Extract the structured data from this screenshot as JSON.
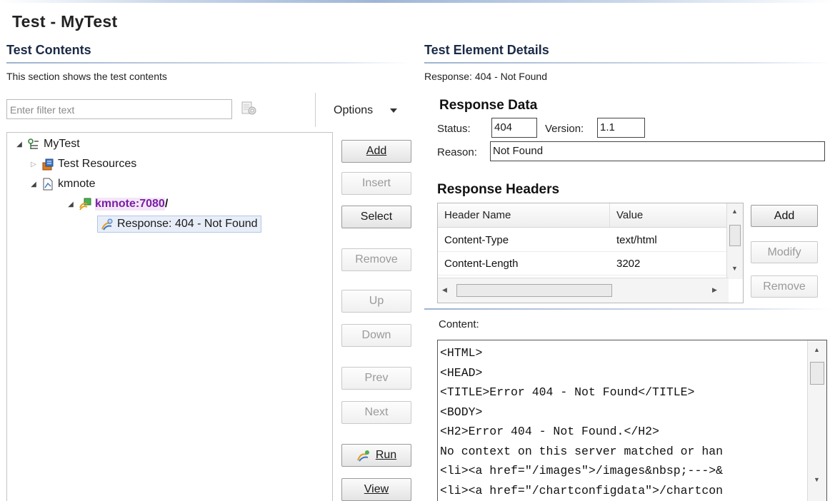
{
  "editor": {
    "title": "Test - MyTest"
  },
  "left": {
    "section_title": "Test Contents",
    "description": "This section shows the test contents",
    "filter_placeholder": "Enter filter text",
    "options_label": "Options",
    "tree": {
      "root": "MyTest",
      "resources": "Test Resources",
      "server": "kmnote",
      "url_host": "kmnote:7080",
      "url_path": "/",
      "response": "Response: 404 - Not Found"
    },
    "buttons": {
      "add": "Add",
      "insert": "Insert",
      "select": "Select",
      "remove": "Remove",
      "up": "Up",
      "down": "Down",
      "prev": "Prev",
      "next": "Next",
      "run": "Run",
      "view": "View"
    }
  },
  "right": {
    "section_title": "Test Element Details",
    "element_label": "Response: 404 - Not Found",
    "response_data": {
      "title": "Response Data",
      "status_label": "Status:",
      "status_value": "404",
      "version_label": "Version:",
      "version_value": "1.1",
      "reason_label": "Reason:",
      "reason_value": "Not Found"
    },
    "response_headers": {
      "title": "Response Headers",
      "columns": [
        "Header Name",
        "Value"
      ],
      "rows": [
        [
          "Content-Type",
          "text/html"
        ],
        [
          "Content-Length",
          "3202"
        ]
      ],
      "buttons": {
        "add": "Add",
        "modify": "Modify",
        "remove": "Remove"
      }
    },
    "content": {
      "label": "Content:",
      "lines": [
        "<HTML>",
        "<HEAD>",
        "<TITLE>Error 404 - Not Found</TITLE>",
        "<BODY>",
        "<H2>Error 404 - Not Found.</H2>",
        "No context on this server matched or han",
        "<li><a href=\"/images\">/images&nbsp;--->&",
        "<li><a href=\"/chartconfigdata\">/chartcon"
      ]
    }
  },
  "colors": {
    "accent_link": "#7a1fa2",
    "selection_bg": "#e8eef8",
    "section_title": "#1b2a45"
  }
}
